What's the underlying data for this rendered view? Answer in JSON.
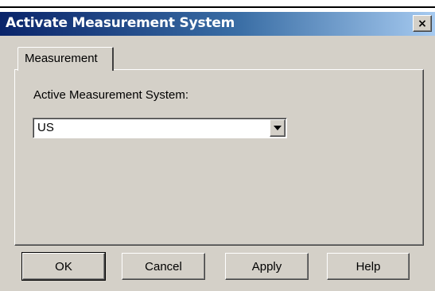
{
  "window": {
    "title": "Activate Measurement System",
    "close_glyph": "×"
  },
  "tabs": [
    {
      "label": "Measurement"
    }
  ],
  "measurement": {
    "label": "Active Measurement System:",
    "selected_value": "US"
  },
  "buttons": {
    "ok": "OK",
    "cancel": "Cancel",
    "apply": "Apply",
    "help": "Help"
  },
  "colors": {
    "titlebar_start": "#0a246a",
    "titlebar_end": "#a6caf0",
    "dialog_face": "#d4d0c8"
  }
}
